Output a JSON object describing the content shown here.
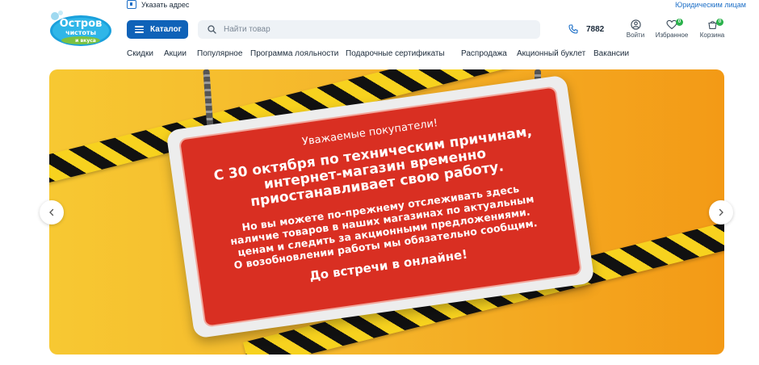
{
  "topbar": {
    "address_link": "Указать адрес",
    "legal_link": "Юридическим лицам"
  },
  "logo": {
    "line1": "Остров",
    "line2": "чистоты",
    "line3": "и вкуса"
  },
  "header": {
    "catalog_label": "Каталог",
    "search_placeholder": "Найти товар",
    "phone": "7882",
    "account_label": "Войти",
    "favorites_label": "Избранное",
    "favorites_count": "0",
    "cart_label": "Корзина",
    "cart_count": "0"
  },
  "nav": {
    "items": [
      "Скидки",
      "Акции",
      "Популярное",
      "Программа лояльности",
      "Подарочные сертификаты",
      "Распродажа",
      "Акционный буклет",
      "Вакансии"
    ]
  },
  "banner": {
    "greeting": "Уважаемые покупатели!",
    "main_line1": "С 30 октября по техническим причинам,",
    "main_line2": "интернет-магазин временно",
    "main_line3": "приостанавливает свою работу.",
    "sub_line1": "Но вы можете по-прежнему отслеживать здесь",
    "sub_line2": "наличие товаров в наших магазинах по актуальным",
    "sub_line3": "ценам и следить за акционными предложениями.",
    "sub_line4": "О возобновлении работы мы обязательно сообщим.",
    "farewell": "До встречи в онлайне!"
  },
  "colors": {
    "brand_blue": "#0f62b8",
    "link_blue": "#1d6fc7",
    "badge_green": "#2bb24c",
    "sign_red": "#d92f22"
  }
}
